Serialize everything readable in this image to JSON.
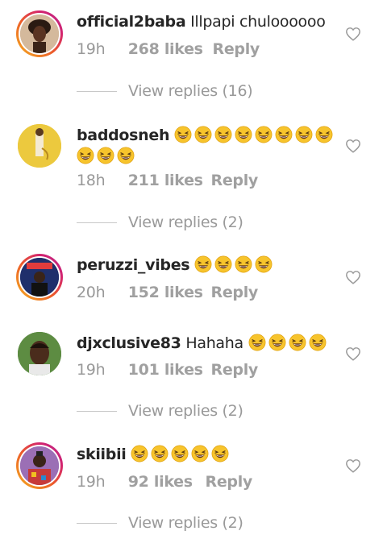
{
  "comments": [
    {
      "username": "official2baba",
      "text": "Illpapi chuloooooo",
      "emoji_count": 0,
      "time": "19h",
      "likes": "268 likes",
      "reply": "Reply",
      "view_replies": "View replies (16)",
      "avatar_story": true
    },
    {
      "username": "baddosneh",
      "text": "",
      "emoji_count": 11,
      "time": "18h",
      "likes": "211 likes",
      "reply": "Reply",
      "view_replies": "View replies (2)",
      "avatar_story": false
    },
    {
      "username": "peruzzi_vibes",
      "text": "",
      "emoji_count": 4,
      "time": "20h",
      "likes": "152 likes",
      "reply": "Reply",
      "view_replies": "",
      "avatar_story": true
    },
    {
      "username": "djxclusive83",
      "text": "Hahaha",
      "emoji_count": 4,
      "time": "19h",
      "likes": "101 likes",
      "reply": "Reply",
      "view_replies": "View replies (2)",
      "avatar_story": false
    },
    {
      "username": "skiibii",
      "text": "",
      "emoji_count": 5,
      "time": "19h",
      "likes": "92 likes",
      "reply": "Reply",
      "view_replies": "View replies (2)",
      "avatar_story": true
    }
  ],
  "colors": {
    "story_ring_start": "#f5b120",
    "story_ring_end": "#b72a8f",
    "muted_text": "#999999",
    "username": "#262626"
  },
  "icons": {
    "like": "heart-outline-icon",
    "emoji": "grinning-squinting-face-emoji"
  }
}
